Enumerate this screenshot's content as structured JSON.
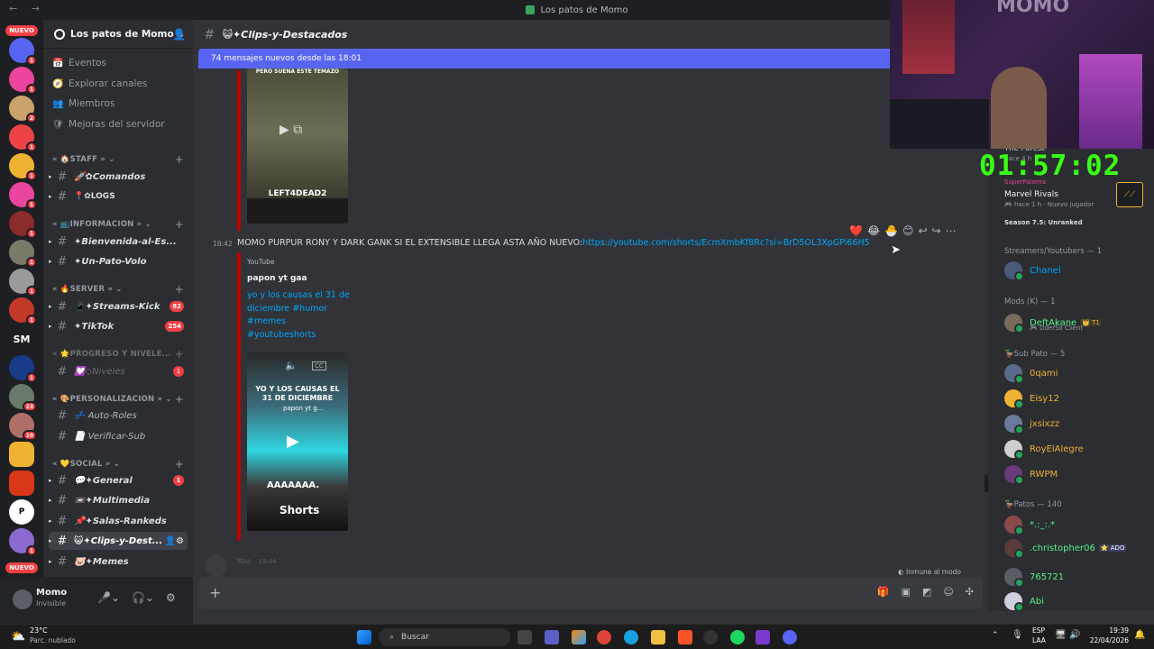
{
  "window": {
    "title": "Los patos de Momo"
  },
  "guilds": {
    "nuevo_top": "NUEVO",
    "nuevo_bottom": "NUEVO",
    "sm_label": "SM",
    "badges": [
      "1",
      "1",
      "2",
      "1",
      "1",
      "1",
      "1",
      "1",
      "1",
      "1",
      "1",
      "23",
      "10",
      "1"
    ]
  },
  "server": {
    "name": "Los patos de Momo ⌄"
  },
  "sidebar": {
    "top_items": [
      {
        "icon": "📅",
        "label": "Eventos"
      },
      {
        "icon": "🧭",
        "label": "Explorar canales"
      },
      {
        "icon": "👥",
        "label": "Miembros"
      },
      {
        "icon": "🛡",
        "label": "Mejoras del servidor"
      }
    ],
    "categories": {
      "staff": "« 🏠STAFF » ⌄",
      "informacion": "« 📺INFORMACION » ⌄",
      "server": "« 🔥SERVER » ⌄",
      "progreso": "« 🌟PROGRESO Y NIVELE...",
      "personalizacion": "« 🎨PERSONALIZACION » ⌄",
      "social": "« 💛SOCIAL » ⌄"
    },
    "channels": {
      "comandos": "🚀✿Comandos",
      "logs": "📍✿LOGS",
      "bienvenida": "✦Bienvenida-al-Es...",
      "unpato": "✦Un-Pato-Volo",
      "streams": "📱✦Streams-Kick",
      "streams_badge": "82",
      "tiktok": "✦TikTok",
      "tiktok_badge": "254",
      "niveles": "💟◇Niveles",
      "niveles_badge": "1",
      "autoroles": "💤 Auto-Roles",
      "verificar": "📄 Verificar-Sub",
      "general": "💬✦General",
      "general_badge": "1",
      "multimedia": "📼✦Multimedia",
      "salas": "📌✦Salas-Rankeds",
      "clips": "😺✦Clips-y-Dest...",
      "memes": "🐷✦Memes"
    }
  },
  "user": {
    "name": "Momo",
    "status": "Invisible"
  },
  "chat": {
    "channel_name": "😺✦Clips-y-Destacados",
    "new_banner": "74 mensajes nuevos desde las 18:01",
    "msg_time": "18:42",
    "msg_text": "MOMO PURPUR RONY Y DARK GANK SI EL EXTENSIBLE LLEGA ASTA AÑO NUEVO:",
    "msg_link": "https://youtube.com/shorts/EcmXmbKf8Rc?si=BrD5OL3XpGPi66H5",
    "thumb1_caption": "PERO SUENA ESTE TEMAZO",
    "thumb1_game": "LEFT4DEAD2",
    "embed_provider": "YouTube",
    "embed_author": "papon yt gaa",
    "embed_desc": "yo y los causas el 31 de diciembre #humor #memes #youtubeshorts",
    "thumb2_title": "YO Y LOS CAUSAS EL 31 DE DICIEMBRE",
    "thumb2_channel": "papon yt g...",
    "thumb2_scream": "AAAAAAA.",
    "thumb2_shorts": "Shorts",
    "typing_user": "You",
    "typing_time": "19:44",
    "pause_notice": "Inmune al modo pausado",
    "reactions": [
      "❤️",
      "😂",
      "🐣",
      "😊",
      "↩",
      "↪",
      "⋯"
    ]
  },
  "members": {
    "activity_top": "The Forest",
    "activity_sub": "hace 4 h",
    "activity_user": "SuperPaloma",
    "activity_game": "Marvel Rivals",
    "activity_time": "hace 1 h",
    "activity_status": "Nuevo jugador",
    "activity_season": "Season 7.5: Unranked",
    "groups": [
      {
        "title": "Streamers/Youtubers — 1",
        "items": [
          {
            "name": "Chanel",
            "color": "#00a8fc"
          }
        ]
      },
      {
        "title": "Mods (K) — 1",
        "items": [
          {
            "name": "DeftAkane",
            "color": "#57f287",
            "tag": "👑 T1",
            "sub": "🎮 OderSo Client"
          }
        ]
      },
      {
        "title": "🦆Sub Pato — 5",
        "items": [
          {
            "name": "0qami",
            "color": "#f0b232"
          },
          {
            "name": "Eisy12",
            "color": "#f0b232"
          },
          {
            "name": "jxsixzz",
            "color": "#f0b232"
          },
          {
            "name": "RoyElAlegre",
            "color": "#f0b232"
          },
          {
            "name": "RWPM",
            "color": "#f0b232"
          }
        ]
      },
      {
        "title": "🦆Patos — 140",
        "items": [
          {
            "name": "*.:_:.*",
            "color": "#57f287"
          },
          {
            "name": ".christopher06",
            "color": "#57f287",
            "tag": "⭐ ADO"
          },
          {
            "name": "765721",
            "color": "#57f287"
          },
          {
            "name": "Abi",
            "color": "#57f287"
          }
        ]
      }
    ]
  },
  "stream": {
    "timer": "01:57:02",
    "overlay": "MOMO"
  },
  "taskbar": {
    "temp": "23°C",
    "weather": "Parc. nublado",
    "search": "Buscar",
    "lang1": "ESP",
    "lang2": "LAA",
    "time": "19:39",
    "date": "22/04/2026"
  }
}
